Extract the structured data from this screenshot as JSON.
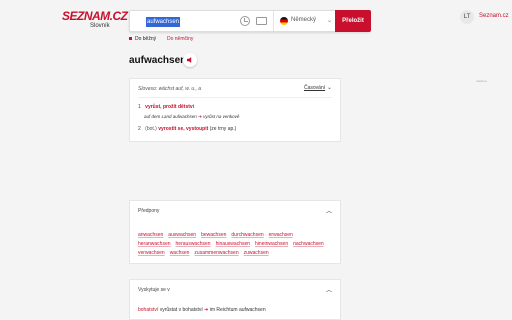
{
  "header": {
    "logo_text": "SEZNAM.CZ",
    "logo_sub": "Slovník",
    "search": {
      "value": "aufwachsen"
    },
    "language": {
      "flag": "germany-flag",
      "label": "Německý"
    },
    "translate_label": "Přeložit",
    "avatar_initials": "LT",
    "home_link": "Seznam.cz"
  },
  "dict_links": [
    "Do běžný",
    "Do němčiny"
  ],
  "headword": "aufwachsen",
  "ad_label": "reklama",
  "entry": {
    "grammar": "Sloveso: wächst auf, w. u., a",
    "sort_label": "Časování",
    "senses": [
      {
        "num": "1",
        "link": "vyrůst, prožít dětství",
        "example_de": "auf dem Land aufwachsen",
        "example_cs": "vyrůst na venkově"
      },
      {
        "num": "2",
        "note": "(bot.)",
        "link": "vyrostit se, vystoupit",
        "tail": "(ze trny ap.)"
      }
    ]
  },
  "prefixes": {
    "title": "Předpony",
    "rows": [
      [
        "anwachsen",
        "auswachsen",
        "bewachsen",
        "durchwachsen",
        "erwachsen"
      ],
      [
        "heranwachsen",
        "herauswachsen",
        "hinauswachsen",
        "hineinwachsen",
        "nachwachsen"
      ],
      [
        "verwachsen",
        "wachsen",
        "zusammenwachsen",
        "zuwachsen"
      ]
    ]
  },
  "occurrences": {
    "title": "Vyskytuje se v",
    "entry_word": "bohatství",
    "entry_cs": "vyrůstat v bohatství",
    "entry_de_pre": "im Reichtum",
    "entry_de_word": "aufwachsen"
  },
  "colors": {
    "accent": "#c8102e",
    "background": "#f4f4f4"
  }
}
